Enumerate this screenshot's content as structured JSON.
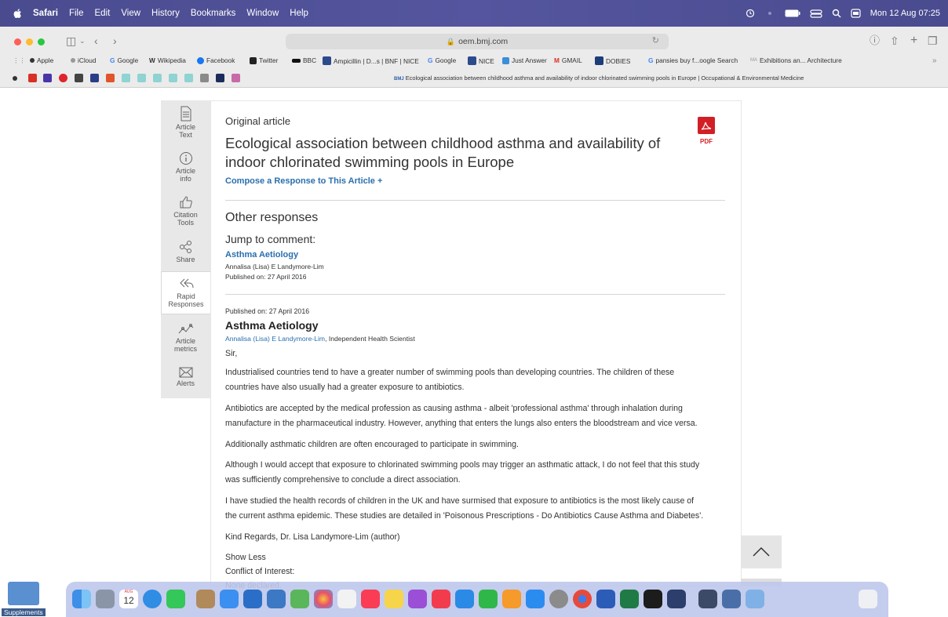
{
  "menubar": {
    "app_name": "Safari",
    "items": [
      "File",
      "Edit",
      "View",
      "History",
      "Bookmarks",
      "Window",
      "Help"
    ],
    "clock": "Mon 12 Aug  07:25"
  },
  "browser": {
    "address": "oem.bmj.com",
    "bookmarks": [
      "Apple",
      "iCloud",
      "Google",
      "Wikipedia",
      "Facebook",
      "Twitter",
      "BBC",
      "Ampicillin | D...s | BNF | NICE",
      "Google",
      "NICE",
      "Just Answer",
      "GMAIL",
      "DOBIES",
      "pansies buy f...oogle Search",
      "Exhibitions an... Architecture"
    ],
    "tab_title": "Ecological association between childhood asthma and availability of indoor chlorinated swimming pools in Europe | Occupational & Environmental Medicine",
    "tab_prefix": "BMJ"
  },
  "sidebar": {
    "items": [
      {
        "label1": "Article",
        "label2": "Text"
      },
      {
        "label1": "Article",
        "label2": "info"
      },
      {
        "label1": "Citation",
        "label2": "Tools"
      },
      {
        "label1": "Share",
        "label2": ""
      },
      {
        "label1": "Rapid",
        "label2": "Responses"
      },
      {
        "label1": "Article",
        "label2": "metrics"
      },
      {
        "label1": "Alerts",
        "label2": ""
      }
    ]
  },
  "article": {
    "type_label": "Original article",
    "title": "Ecological association between childhood asthma and availability of indoor chlorinated swimming pools in Europe",
    "pdf_label": "PDF",
    "compose_link": "Compose a Response to This Article +",
    "other_responses": "Other responses",
    "jump_to": "Jump to comment:",
    "jump_link": "Asthma Aetiology",
    "jump_author": "Annalisa (Lisa) E Landymore-Lim",
    "jump_date": "Published on: 27 April 2016"
  },
  "response": {
    "published": "Published on: 27 April 2016",
    "title": "Asthma Aetiology",
    "author_link": "Annalisa (Lisa) E Landymore-Lim",
    "author_role": ", Independent Health Scientist",
    "salutation": "Sir,",
    "p1_l1": "Industrialised countries tend to have a greater number of swimming pools than developing countries. The children of these",
    "p1_l2": "countries have also usually had a greater exposure to antibiotics.",
    "p2_l1": "Antibiotics are accepted by the medical profession as causing asthma - albeit 'professional asthma' through inhalation during",
    "p2_l2": "manufacture in the pharmaceutical industry. However, anything that enters the lungs also enters the bloodstream and vice versa.",
    "p3": "Additionally asthmatic children are often encouraged to participate in swimming.",
    "p4_l1": "Although I would accept that exposure to chlorinated swimming pools may trigger an asthmatic attack, I do not feel that this study",
    "p4_l2": "was sufficiently comprehensive to conclude a direct association.",
    "p5_l1": "I have studied the health records of children in the UK and have surmised that exposure to antibiotics is the most likely cause of",
    "p5_l2": "the current asthma epidemic. These studies are detailed in 'Poisonous Prescriptions - Do Antibiotics Cause Asthma and Diabetes'.",
    "signoff": "Kind Regards, Dr. Lisa Landymore-Lim (author)",
    "show_less": "Show Less",
    "conflict_label": "Conflict of Interest:",
    "conflict_value": "None declared."
  },
  "dock": {
    "calendar_day": "12",
    "calendar_month": "AUG",
    "desktop_label": "Supplements"
  },
  "colors": {
    "menubar": "#4f5096",
    "link": "#2a6fad",
    "pdf_red": "#d21f26"
  }
}
